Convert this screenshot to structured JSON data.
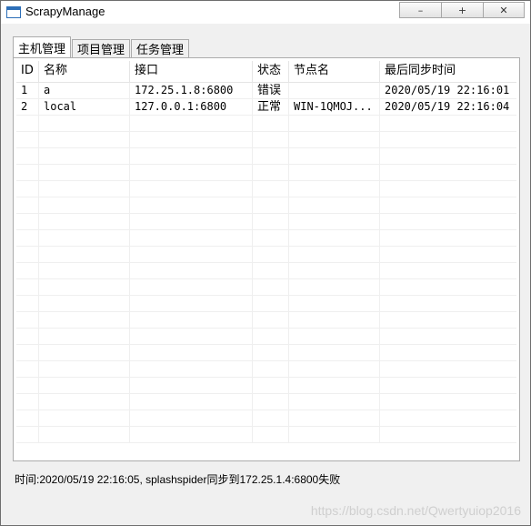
{
  "window": {
    "title": "ScrapyManage",
    "buttons": {
      "minimize": "–",
      "maximize": "+",
      "close": "✕"
    }
  },
  "tabs": [
    {
      "label": "主机管理",
      "active": true
    },
    {
      "label": "项目管理",
      "active": false
    },
    {
      "label": "任务管理",
      "active": false
    }
  ],
  "table": {
    "headers": [
      "ID",
      "名称",
      "接口",
      "状态",
      "节点名",
      "最后同步时间"
    ],
    "rows": [
      [
        "1",
        "a",
        "172.25.1.8:6800",
        "错误",
        "",
        "2020/05/19 22:16:01"
      ],
      [
        "2",
        "local",
        "127.0.0.1:6800",
        "正常",
        "WIN-1QMOJ...",
        "2020/05/19 22:16:04"
      ]
    ],
    "empty_rows": 20
  },
  "status": {
    "text": "时间:2020/05/19 22:16:05, splashspider同步到172.25.1.4:6800失败"
  },
  "watermark": "https://blog.csdn.net/Qwertyuiop2016"
}
